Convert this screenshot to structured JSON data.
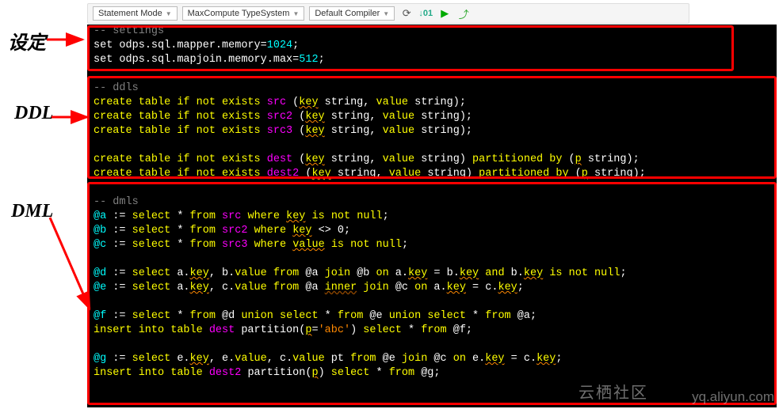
{
  "toolbar": {
    "dd1": "Statement Mode",
    "dd2": "MaxCompute TypeSystem",
    "dd3": "Default Compiler"
  },
  "labels": {
    "settings": "设定",
    "ddl": "DDL",
    "dml": "DML"
  },
  "watermark": {
    "cn": "云栖社区",
    "url": "yq.aliyun.com"
  },
  "code": {
    "c_settings": "-- settings",
    "set1_a": "set",
    "set1_b": " odps.sql.mapper.memory=",
    "set1_c": "1024",
    "set1_d": ";",
    "set2_a": "set",
    "set2_b": " odps.sql.mapjoin.memory.max=",
    "set2_c": "512",
    "set2_d": ";",
    "c_ddls": "-- ddls",
    "ddl1_a": "create table if not exists ",
    "ddl1_b": "src",
    "ddl1_c": " (",
    "ddl1_d": "key",
    "ddl1_e": " string, ",
    "ddl1_f": "value",
    "ddl1_g": " string);",
    "ddl2_a": "create table if not exists ",
    "ddl2_b": "src2",
    "ddl2_c": " (",
    "ddl2_d": "key",
    "ddl2_e": " string, ",
    "ddl2_f": "value",
    "ddl2_g": " string);",
    "ddl3_a": "create table if not exists ",
    "ddl3_b": "src3",
    "ddl3_c": " (",
    "ddl3_d": "key",
    "ddl3_e": " string, ",
    "ddl3_f": "value",
    "ddl3_g": " string);",
    "ddl4_a": "create table if not exists ",
    "ddl4_b": "dest",
    "ddl4_c": " (",
    "ddl4_d": "key",
    "ddl4_e": " string, ",
    "ddl4_f": "value",
    "ddl4_g": " string) ",
    "ddl4_h": "partitioned by",
    "ddl4_i": " (",
    "ddl4_j": "p",
    "ddl4_k": " string);",
    "ddl5_a": "create table if not exists ",
    "ddl5_b": "dest2",
    "ddl5_c": " (",
    "ddl5_d": "key",
    "ddl5_e": " string, ",
    "ddl5_f": "value",
    "ddl5_g": " string) ",
    "ddl5_h": "partitioned by",
    "ddl5_i": " (",
    "ddl5_j": "p",
    "ddl5_k": " string);",
    "c_dmls": "-- dmls",
    "da_1": "@a",
    "da_2": " := ",
    "da_3": "select",
    "da_4": " * ",
    "da_5": "from",
    "da_6": " ",
    "da_7": "src",
    "da_8": " ",
    "da_9": "where",
    "da_10": " ",
    "da_11": "key",
    "da_12": " ",
    "da_13": "is not null",
    "da_14": ";",
    "db_1": "@b",
    "db_2": " := ",
    "db_3": "select",
    "db_4": " * ",
    "db_5": "from",
    "db_6": " ",
    "db_7": "src2",
    "db_8": " ",
    "db_9": "where",
    "db_10": " ",
    "db_11": "key",
    "db_12": " <> 0;",
    "dc_1": "@c",
    "dc_2": " := ",
    "dc_3": "select",
    "dc_4": " * ",
    "dc_5": "from",
    "dc_6": " ",
    "dc_7": "src3",
    "dc_8": " ",
    "dc_9": "where",
    "dc_10": " ",
    "dc_11": "value",
    "dc_12": " ",
    "dc_13": "is not null",
    "dc_14": ";",
    "dd_1": "@d",
    "dd_2": " := ",
    "dd_3": "select",
    "dd_4": " a.",
    "dd_5": "key",
    "dd_6": ", b.",
    "dd_7": "value",
    "dd_8": " ",
    "dd_9": "from",
    "dd_10": " @a ",
    "dd_11": "join",
    "dd_12": " @b ",
    "dd_13": "on",
    "dd_14": " a.",
    "dd_15": "key",
    "dd_16": " = b.",
    "dd_17": "key",
    "dd_18": " ",
    "dd_19": "and",
    "dd_20": " b.",
    "dd_21": "key",
    "dd_22": " ",
    "dd_23": "is not null",
    "dd_24": ";",
    "de_1": "@e",
    "de_2": " := ",
    "de_3": "select",
    "de_4": " a.",
    "de_5": "key",
    "de_6": ", c.",
    "de_7": "value",
    "de_8": " ",
    "de_9": "from",
    "de_10": " @a ",
    "de_11": "inner",
    "de_12": " ",
    "de_13": "join",
    "de_14": " @c ",
    "de_15": "on",
    "de_16": " a.",
    "de_17": "key",
    "de_18": " = c.",
    "de_19": "key",
    "de_20": ";",
    "df_1": "@f",
    "df_2": " := ",
    "df_3": "select",
    "df_4": " * ",
    "df_5": "from",
    "df_6": " @d ",
    "df_7": "union",
    "df_8": " ",
    "df_9": "select",
    "df_10": " * ",
    "df_11": "from",
    "df_12": " @e ",
    "df_13": "union",
    "df_14": " ",
    "df_15": "select",
    "df_16": " * ",
    "df_17": "from",
    "df_18": " @a;",
    "ins1_1": "insert into table ",
    "ins1_2": "dest",
    "ins1_3": " partition(",
    "ins1_4": "p",
    "ins1_5": "=",
    "ins1_6": "'abc'",
    "ins1_7": ") ",
    "ins1_8": "select",
    "ins1_9": " * ",
    "ins1_10": "from",
    "ins1_11": " @f;",
    "dg_1": "@g",
    "dg_2": " := ",
    "dg_3": "select",
    "dg_4": " e.",
    "dg_5": "key",
    "dg_6": ", e.",
    "dg_7": "value",
    "dg_8": ", c.",
    "dg_9": "value",
    "dg_10": " pt ",
    "dg_11": "from",
    "dg_12": " @e ",
    "dg_13": "join",
    "dg_14": " @c ",
    "dg_15": "on",
    "dg_16": " e.",
    "dg_17": "key",
    "dg_18": " = c.",
    "dg_19": "key",
    "dg_20": ";",
    "ins2_1": "insert into table ",
    "ins2_2": "dest2",
    "ins2_3": " partition(",
    "ins2_4": "p",
    "ins2_5": ") ",
    "ins2_6": "select",
    "ins2_7": " * ",
    "ins2_8": "from",
    "ins2_9": " @g;"
  }
}
